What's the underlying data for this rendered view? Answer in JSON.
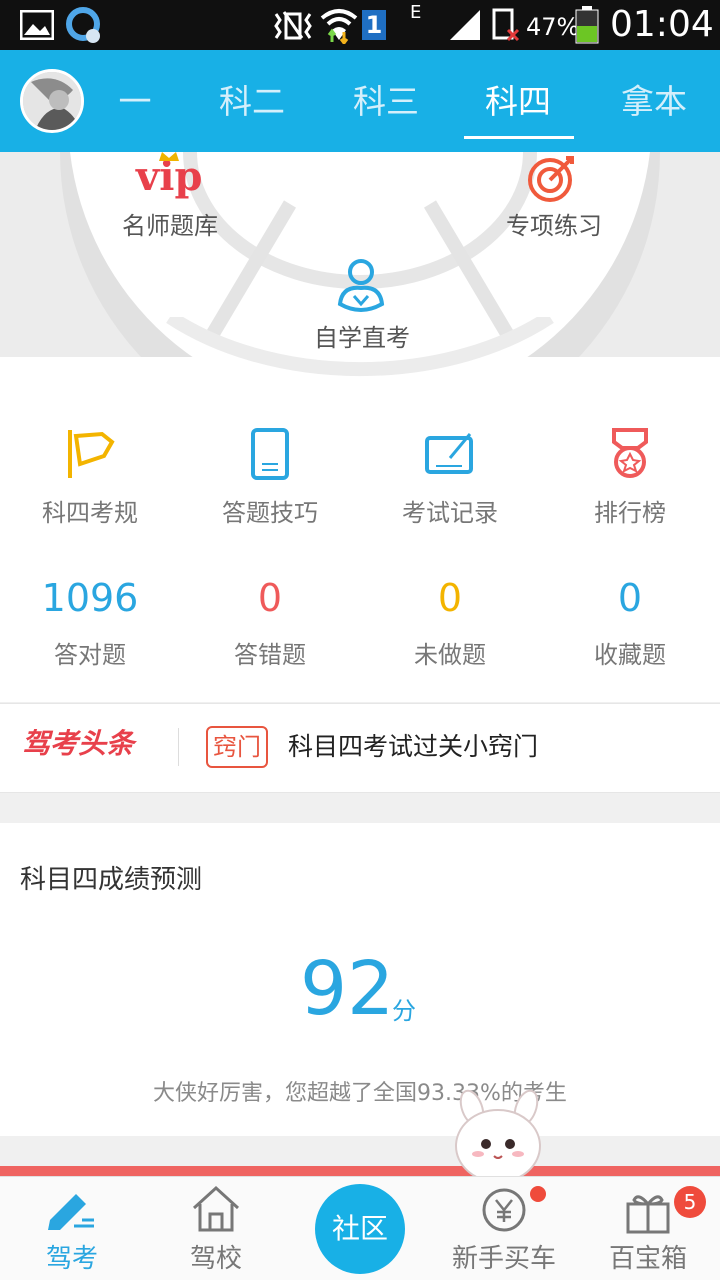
{
  "status_bar": {
    "battery": "47%",
    "time": "01:04",
    "sim": "1",
    "network": "E"
  },
  "header": {
    "tabs": [
      "一",
      "科二",
      "科三",
      "科四",
      "拿本"
    ],
    "active_tab": "科四"
  },
  "wheel": {
    "vip": "vip",
    "teacher_bank": "名师题库",
    "special": "专项练习",
    "self_study": "自学直考"
  },
  "tools": [
    {
      "label": "科四考规",
      "icon": "flag-icon"
    },
    {
      "label": "答题技巧",
      "icon": "phone-icon"
    },
    {
      "label": "考试记录",
      "icon": "record-icon"
    },
    {
      "label": "排行榜",
      "icon": "medal-icon"
    }
  ],
  "stats": [
    {
      "value": "1096",
      "label": "答对题",
      "color": "#2aa6e0"
    },
    {
      "value": "0",
      "label": "答错题",
      "color": "#ef5a5a"
    },
    {
      "value": "0",
      "label": "未做题",
      "color": "#f3b400"
    },
    {
      "value": "0",
      "label": "收藏题",
      "color": "#2aa6e0"
    }
  ],
  "news": {
    "brand": "驾考头条",
    "tag": "窍门",
    "headline": "科目四考试过关小窍门"
  },
  "prediction": {
    "title": "科目四成绩预测",
    "score": "92",
    "unit": "分",
    "message": "大侠好厉害，您超越了全国93.33%的考生"
  },
  "bottom_nav": {
    "items": [
      "驾考",
      "驾校",
      "社区",
      "新手买车",
      "百宝箱"
    ],
    "badge": "5"
  },
  "colors": {
    "accent": "#18b0e6",
    "red": "#ef5a5a"
  }
}
